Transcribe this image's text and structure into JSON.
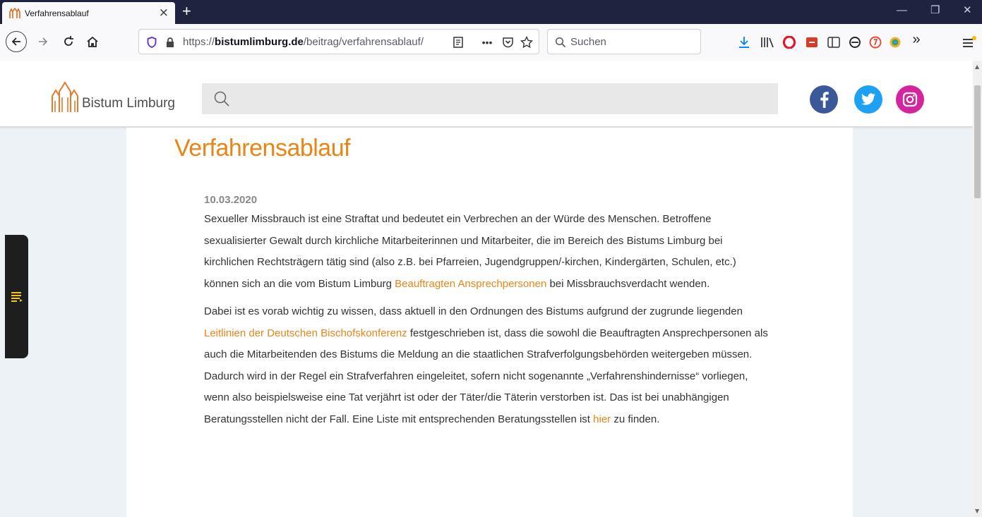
{
  "browser": {
    "tab_title": "Verfahrensablauf",
    "tab_close": "×",
    "new_tab": "+",
    "url_prefix": "https://",
    "url_domain": "bistumlimburg.de",
    "url_path": "/beitrag/verfahrensablauf/",
    "page_actions": "•••",
    "search_placeholder": "Suchen",
    "overflow": "»",
    "window_minimize": "—",
    "window_restore": "❐",
    "window_close": "✕"
  },
  "site": {
    "logo_text": "Bistum Limburg",
    "accent_color": "#ea8515"
  },
  "article": {
    "title": "Verfahrensablauf",
    "date": "10.03.2020",
    "p1_a": "Sexueller Missbrauch ist eine Straftat und bedeutet ein Verbrechen an der Würde des Menschen. Betroffene sexualisierter Gewalt durch kirchliche Mitarbeiterinnen und Mitarbeiter, die im Bereich des Bistums Limburg bei kirchlichen Rechtsträgern tätig sind (also z.B. bei Pfarreien, Jugendgruppen/-kirchen, Kindergärten, Schulen, etc.) können sich an die vom Bistum Limburg ",
    "p1_link": "Beauftragten Ansprechpersonen",
    "p1_b": " bei Missbrauchsverdacht wenden.",
    "p2_a": "Dabei ist es vorab wichtig zu wissen, dass aktuell in den Ordnungen des Bistums aufgrund der zugrunde liegenden ",
    "p2_link": "Leitlinien der Deutschen Bischofskonferenz",
    "p2_b": " festgeschrieben ist, dass die sowohl die Beauftragten Ansprechpersonen als auch die Mitarbeitenden des Bistums die Meldung an die staatlichen Strafverfolgungsbehörden weitergeben müssen. Dadurch wird in der Regel ein Strafverfahren eingeleitet, sofern nicht sogenannte „Verfahrenshindernisse“ vorliegen, wenn also beispielsweise eine Tat verjährt ist oder der Täter/die Täterin verstorben ist. Das ist bei unabhängigen Beratungsstellen nicht der Fall. Eine Liste mit entsprechenden Beratungsstellen ist ",
    "p2_link2": "hier",
    "p2_c": " zu finden."
  },
  "icons": {
    "back": "back-arrow-icon",
    "forward": "forward-arrow-icon",
    "reload": "reload-icon",
    "home": "home-icon",
    "social": [
      "facebook-icon",
      "twitter-icon",
      "instagram-icon"
    ],
    "toc": "table-of-contents-icon"
  }
}
